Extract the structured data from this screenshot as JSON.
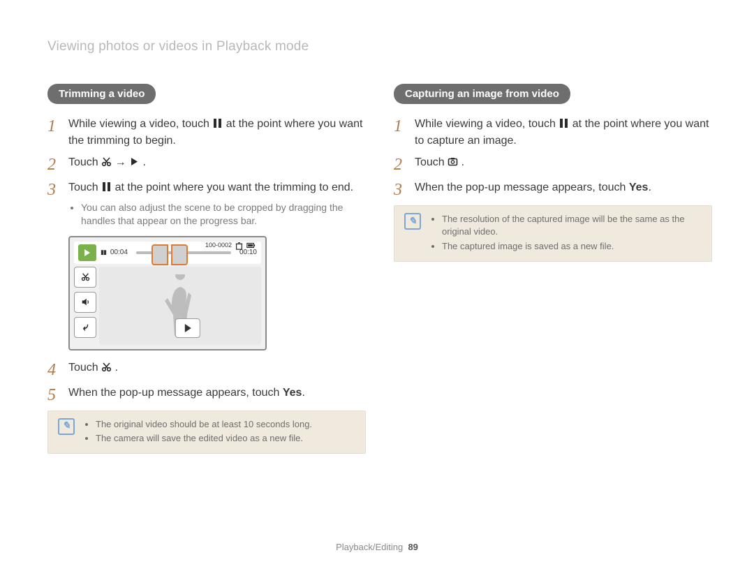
{
  "header": {
    "breadcrumb": "Viewing photos or videos in Playback mode"
  },
  "footer": {
    "section": "Playback/Editing",
    "page": "89"
  },
  "icons": {
    "pause": "pause-icon",
    "scissors": "scissors-icon",
    "arrow_right": "arrow-right-icon",
    "play": "play-icon",
    "capture": "capture-frame-icon",
    "speaker": "speaker-icon",
    "back": "back-arrow-icon",
    "note": "note-icon"
  },
  "left": {
    "title": "Trimming a video",
    "steps": {
      "s1": {
        "pre": "While viewing a video, touch ",
        "post": " at the point where you want the trimming to begin."
      },
      "s2": {
        "pre": "Touch ",
        "mid": " → ",
        "post": "."
      },
      "s3": {
        "pre": "Touch ",
        "post": " at the point where you want the trimming to end."
      },
      "s3_bullets": [
        "You can also adjust the scene to be cropped by dragging the handles that appear on the progress bar."
      ],
      "s4": {
        "pre": "Touch ",
        "post": "."
      },
      "s5": {
        "pre": "When the pop-up message appears, touch ",
        "bold": "Yes",
        "post": "."
      }
    },
    "screenshot": {
      "file_index": "100-0002",
      "time_elapsed": "00:04",
      "time_total": "00:10"
    },
    "note": [
      "The original video should be at least 10 seconds long.",
      "The camera will save the edited video as a new file."
    ]
  },
  "right": {
    "title": "Capturing an image from video",
    "steps": {
      "s1": {
        "pre": "While viewing a video, touch ",
        "post": " at the point where you want to capture an image."
      },
      "s2": {
        "pre": "Touch ",
        "post": "."
      },
      "s3": {
        "pre": "When the pop-up message appears, touch ",
        "bold": "Yes",
        "post": "."
      }
    },
    "note": [
      "The resolution of the captured image will be the same as the original video.",
      "The captured image is saved as a new file."
    ]
  }
}
